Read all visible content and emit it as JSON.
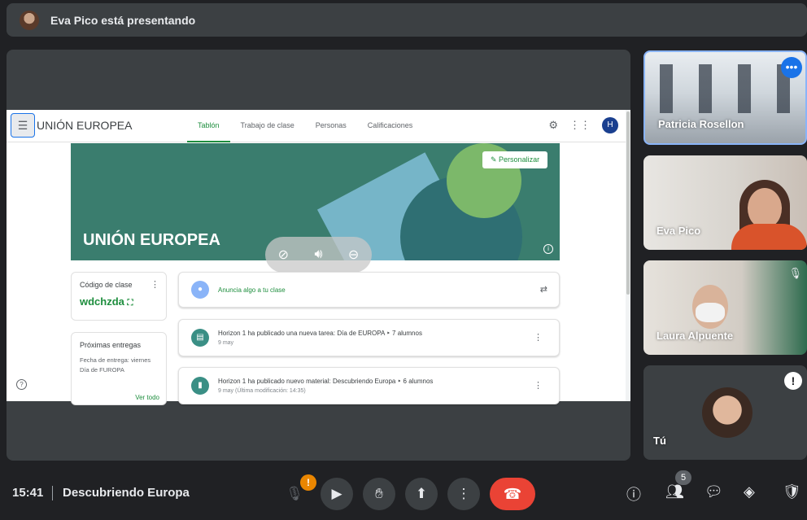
{
  "topbar": {
    "presenting_text": "Eva Pico está presentando"
  },
  "classroom": {
    "class_name": "UNIÓN EUROPEA",
    "tabs": [
      "Tablón",
      "Trabajo de clase",
      "Personas",
      "Calificaciones"
    ],
    "user_initial": "H",
    "banner_title": "UNIÓN EUROPEA",
    "customize_label": "Personalizar",
    "class_code_title": "Código de clase",
    "class_code": "wdchzda",
    "upcoming_title": "Próximas entregas",
    "due_text_1": "Fecha de entrega: viernes",
    "due_text_2": "Día de FUROPA",
    "see_all": "Ver todo",
    "announce_placeholder": "Anuncia algo a tu clase",
    "posts": [
      {
        "text": "Horizon 1 ha publicado una nueva tarea: Día de EUROPA ‣ 7 alumnos",
        "date": "9 may"
      },
      {
        "text": "Horizon 1 ha publicado nuevo material: Descubriendo Europa ‣ 6 alumnos",
        "date": "9 may (Última modificación: 14:35)"
      }
    ]
  },
  "participants": [
    {
      "name": "Patricia Rosellon"
    },
    {
      "name": "Eva Pico"
    },
    {
      "name": "Laura Alpuente"
    },
    {
      "name": "Tú"
    }
  ],
  "bottombar": {
    "time": "15:41",
    "meeting_name": "Descubriendo Europa",
    "participant_count": "5",
    "mic_warning": "!"
  },
  "colors": {
    "accent_green": "#1e8e3e",
    "hangup_red": "#ea4335",
    "warning_orange": "#ea8600",
    "active_blue": "#1a73e8"
  }
}
